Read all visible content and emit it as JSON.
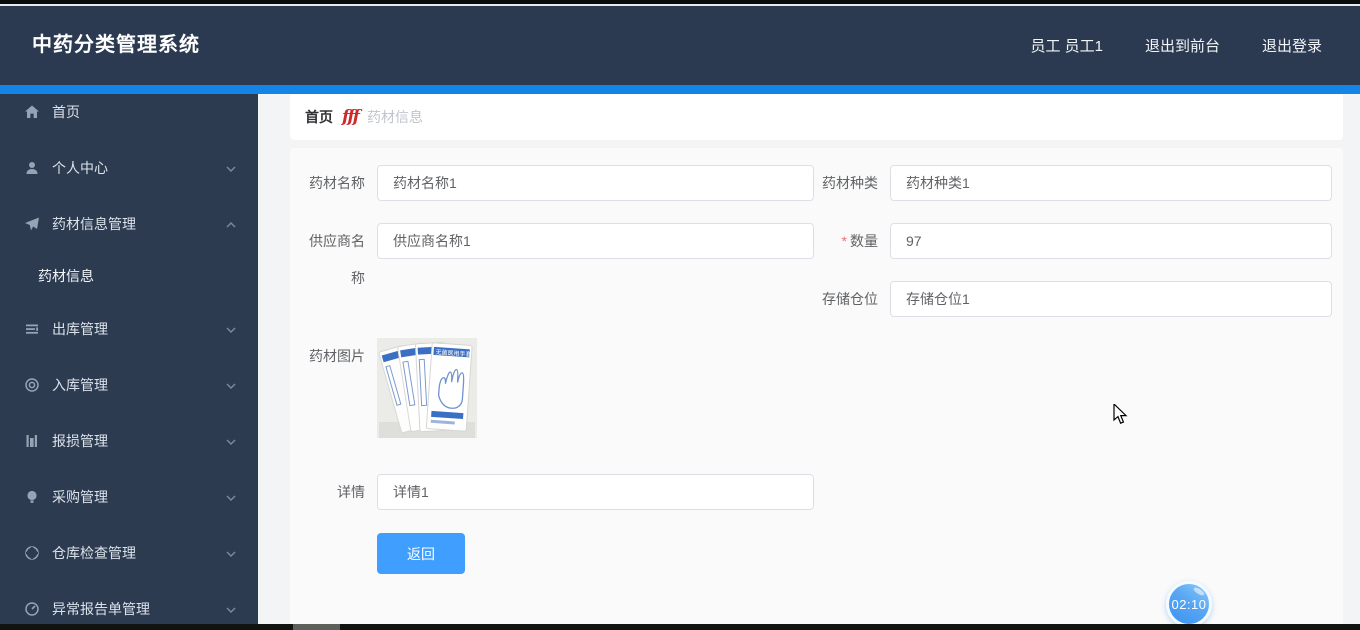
{
  "header": {
    "title": "中药分类管理系统",
    "user_label": "员工 员工1",
    "exit_front_label": "退出到前台",
    "logout_label": "退出登录"
  },
  "sidebar": {
    "items": [
      {
        "label": "首页",
        "icon": "home-icon"
      },
      {
        "label": "个人中心",
        "icon": "user-icon",
        "state": "collapsed"
      },
      {
        "label": "药材信息管理",
        "icon": "send-icon",
        "state": "expanded"
      },
      {
        "label": "药材信息",
        "icon": null,
        "submenu": true,
        "active": true
      },
      {
        "label": "出库管理",
        "icon": "outbound-list-icon",
        "state": "collapsed"
      },
      {
        "label": "入库管理",
        "icon": "inbound-circle-icon",
        "state": "collapsed"
      },
      {
        "label": "报损管理",
        "icon": "damage-chart-icon",
        "state": "collapsed"
      },
      {
        "label": "采购管理",
        "icon": "purchase-bulb-icon",
        "state": "collapsed"
      },
      {
        "label": "仓库检查管理",
        "icon": "warehouse-check-icon",
        "state": "collapsed"
      },
      {
        "label": "异常报告单管理",
        "icon": "abnormal-report-icon",
        "state": "collapsed"
      }
    ]
  },
  "breadcrumb": {
    "home": "首页",
    "separator": "fff",
    "current": "药材信息"
  },
  "form": {
    "material_name": {
      "label": "药材名称",
      "value": "药材名称1"
    },
    "material_type": {
      "label": "药材种类",
      "value": "药材种类1"
    },
    "supplier_name": {
      "label": "供应商名称",
      "value": "供应商名称1"
    },
    "quantity": {
      "label": "数量",
      "required_mark": "*",
      "value": "97"
    },
    "storage_slot": {
      "label": "存储仓位",
      "value": "存储仓位1"
    },
    "material_image": {
      "label": "药材图片",
      "image_desc": "sterile-glove-packets-photo"
    },
    "detail": {
      "label": "详情",
      "value": "详情1"
    },
    "back_button_label": "返回"
  },
  "timer_badge": "02:10",
  "colors": {
    "header_bg": "#2b3a50",
    "accent_bar": "#1285e6",
    "primary_button": "#409eff",
    "breadcrumb_icon_red": "#cc2b2b",
    "required_red": "#f56c6c",
    "panel_bg": "#fafafa"
  }
}
